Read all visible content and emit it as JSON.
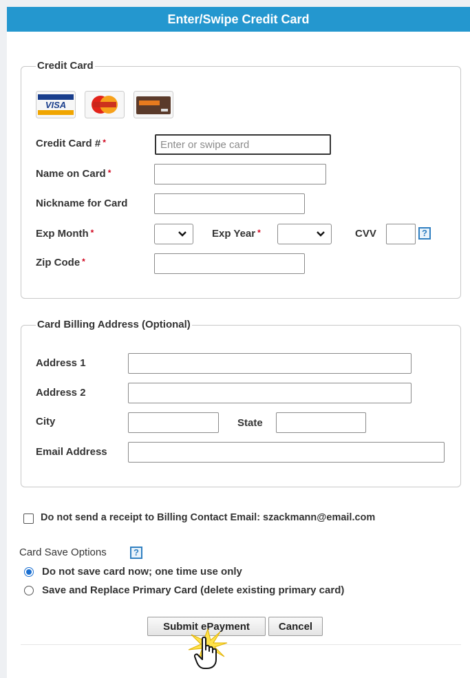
{
  "header": {
    "title": "Enter/Swipe Credit Card"
  },
  "credit_card": {
    "legend": "Credit Card",
    "card_brands": [
      "visa-logo",
      "mastercard-logo",
      "discover-logo"
    ],
    "card_number_label": "Credit Card #",
    "card_number_placeholder": "Enter or swipe card",
    "card_number_value": "",
    "name_label": "Name on Card",
    "name_value": "",
    "nickname_label": "Nickname for Card",
    "nickname_value": "",
    "exp_month_label": "Exp Month",
    "exp_month_value": "",
    "exp_year_label": "Exp Year",
    "exp_year_value": "",
    "cvv_label": "CVV",
    "cvv_value": "",
    "zip_label": "Zip Code",
    "zip_value": "",
    "required_marker": "*"
  },
  "billing_address": {
    "legend": "Card Billing Address (Optional)",
    "address1_label": "Address 1",
    "address2_label": "Address 2",
    "city_label": "City",
    "state_label": "State",
    "email_label": "Email Address"
  },
  "receipt": {
    "checked": false,
    "label": "Do not send a receipt to Billing Contact Email: szackmann@email.com"
  },
  "card_save": {
    "label": "Card Save Options",
    "options": [
      {
        "label": "Do not save card now; one time use only",
        "selected": true
      },
      {
        "label": "Save and Replace Primary Card (delete existing primary card)",
        "selected": false
      }
    ]
  },
  "buttons": {
    "submit": "Submit ePayment",
    "cancel": "Cancel"
  },
  "help_glyph": "?",
  "colors": {
    "header_bg": "#2497cf",
    "required": "#d0021b",
    "help": "#2f7fc1",
    "radio": "#1a6fd1"
  }
}
